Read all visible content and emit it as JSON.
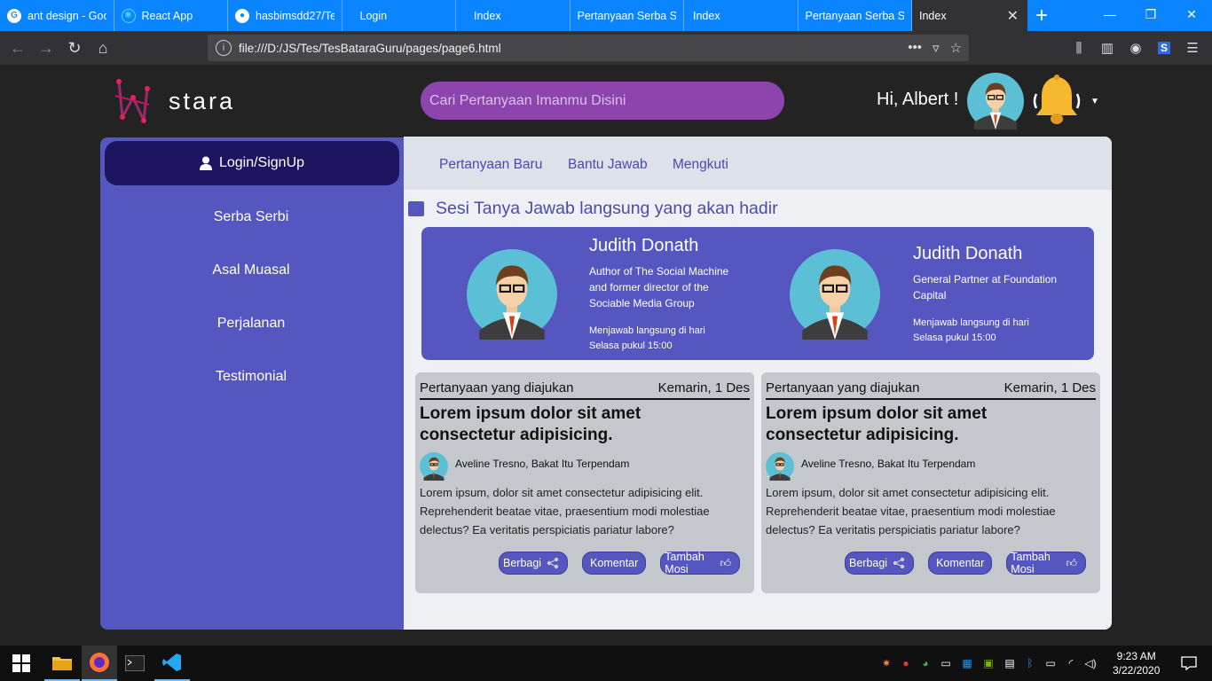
{
  "browser": {
    "tabs": [
      {
        "label": "ant design - Goo",
        "icon": "google-icon",
        "color": "#ffffff"
      },
      {
        "label": "React App",
        "icon": "react-icon",
        "color": "#61dafb"
      },
      {
        "label": "hasbimsdd27/Te",
        "icon": "github-icon",
        "color": "#ffffff"
      },
      {
        "label": "Login",
        "icon": "",
        "color": ""
      },
      {
        "label": "Index",
        "icon": "",
        "color": ""
      },
      {
        "label": "Pertanyaan Serba Se",
        "icon": "",
        "color": ""
      },
      {
        "label": "Index",
        "icon": "",
        "color": ""
      },
      {
        "label": "Pertanyaan Serba Se",
        "icon": "",
        "color": ""
      }
    ],
    "active_tab": "Index",
    "url": "file:///D:/JS/Tes/TesBataraGuru/pages/page6.html"
  },
  "header": {
    "logo_text": "stara",
    "search_placeholder": "Cari Pertanyaan Imanmu Disini",
    "greeting": "Hi, Albert !"
  },
  "sidebar": {
    "login_label": "Login/SignUp",
    "items": [
      "Serba Serbi",
      "Asal Muasal",
      "Perjalanan",
      "Testimonial"
    ]
  },
  "main": {
    "tabs": [
      "Pertanyaan Baru",
      "Bantu Jawab",
      "Mengkuti"
    ],
    "section_title": "Sesi Tanya Jawab langsung yang akan hadir",
    "speakers": [
      {
        "name": "Judith Donath",
        "desc": "Author of The Social Machine and former director of the Sociable Media Group",
        "time": "Menjawab langsung di hari Selasa pukul 15:00"
      },
      {
        "name": "Judith Donath",
        "desc": "General Partner at Foundation Capital",
        "time": "Menjawab langsung di hari Selasa pukul 15:00"
      }
    ],
    "cards": [
      {
        "header_left": "Pertanyaan yang diajukan",
        "header_right": "Kemarin, 1 Des",
        "title": "Lorem ipsum dolor sit amet consectetur adipisicing.",
        "author": "Aveline Tresno, Bakat Itu Terpendam",
        "body": "Lorem ipsum, dolor sit amet consectetur adipisicing elit. Reprehenderit beatae vitae, praesentium modi molestiae delectus? Ea veritatis perspiciatis pariatur labore?",
        "share": "Berbagi",
        "comment": "Komentar",
        "vote": "Tambah Mosi"
      },
      {
        "header_left": "Pertanyaan yang diajukan",
        "header_right": "Kemarin, 1 Des",
        "title": "Lorem ipsum dolor sit amet consectetur adipisicing.",
        "author": "Aveline Tresno, Bakat Itu Terpendam",
        "body": "Lorem ipsum, dolor sit amet consectetur adipisicing elit. Reprehenderit beatae vitae, praesentium modi molestiae delectus? Ea veritatis perspiciatis pariatur labore?",
        "share": "Berbagi",
        "comment": "Komentar",
        "vote": "Tambah Mosi"
      }
    ]
  },
  "taskbar": {
    "time": "9:23 AM",
    "date": "3/22/2020"
  },
  "colors": {
    "accent": "#5656c0",
    "dark_accent": "#1d1560",
    "search_bg": "#8e44ad",
    "browser_blue": "#0a84ff"
  }
}
